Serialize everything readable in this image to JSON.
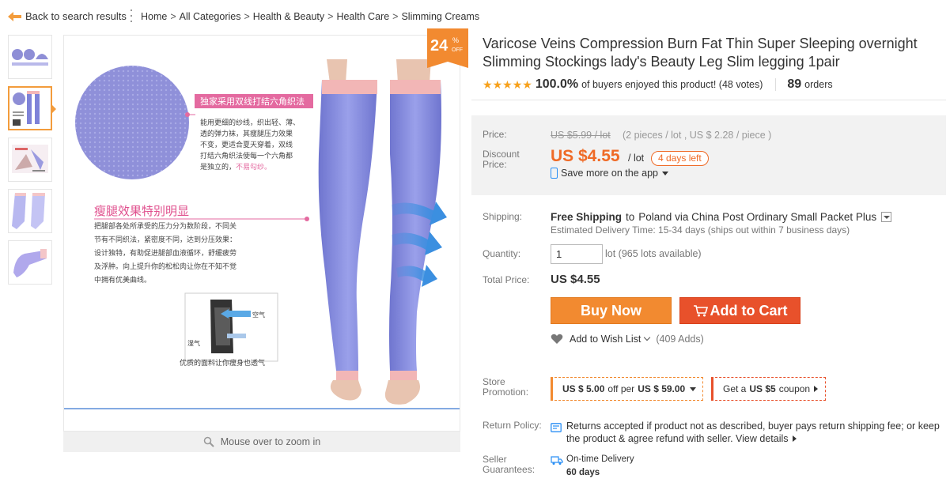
{
  "nav": {
    "back_label": "Back to search results",
    "breadcrumbs": [
      "Home",
      "All Categories",
      "Health & Beauty",
      "Health Care",
      "Slimming Creams"
    ],
    "crumb_sep": ">"
  },
  "gallery": {
    "thumbnail_count": 5,
    "active_index": 1,
    "zoom_hint": "Mouse over to zoom in",
    "main_image_text": {
      "callout_top": "独家采用双线打结六角织法",
      "callout_body": [
        "能用更细的纱线，织出轻、薄、",
        "透的弹力袜，其瘦腿压力效果",
        "不变，更适合夏天穿着，双线",
        "打结六角织法使每一个六角都",
        "是独立的，"
      ],
      "callout_pink": "不易勾纱。",
      "heading": "瘦腿效果特别明显",
      "body": [
        "把腿部各处所承受的压力分为数阶段，不同关",
        "节有不同织法，紧密度不同，达到分压效果：",
        "设计独特，有助促进腿部血液循环，舒缓疲劳",
        "及浮肿。向上提升你的松松肉让你在不知不觉",
        "中拥有优美曲线。"
      ],
      "air_label": "空气",
      "moist_label": "湿气",
      "fabric_caption": "优质的面料让你瘦身也透气"
    },
    "badge": {
      "percent": "24",
      "percent_sign": "%",
      "off": "OFF"
    }
  },
  "product": {
    "title": "Varicose Veins Compression Burn Fat Thin Super Sleeping overnight Slimming Stockings lady's Beauty Leg Slim legging 1pair",
    "rating_stars": 5,
    "rating_pct": "100.0%",
    "rating_text": "of buyers enjoyed this product! (48 votes)",
    "orders_count": "89",
    "orders_label": "orders"
  },
  "pricing": {
    "price_label": "Price:",
    "old_price": "US $5.99 / lot",
    "per_piece": "(2 pieces / lot , US $ 2.28 / piece )",
    "discount_label": "Discount Price:",
    "new_price": "US $4.55",
    "per_lot": "/ lot",
    "days_left": "4 days left",
    "app_text": "Save more on the app"
  },
  "shipping": {
    "label": "Shipping:",
    "free": "Free Shipping",
    "to": "to",
    "destination": "Poland via China Post Ordinary Small Packet Plus",
    "estimate": "Estimated Delivery Time: 15-34 days (ships out within 7 business days)"
  },
  "quantity": {
    "label": "Quantity:",
    "value": "1",
    "available": "lot (965 lots available)"
  },
  "total": {
    "label": "Total Price:",
    "value": "US $4.55"
  },
  "actions": {
    "buy_now": "Buy Now",
    "add_to_cart": "Add to Cart",
    "wish_list": "Add to Wish List",
    "wish_adds": "(409 Adds)"
  },
  "store_promotion": {
    "label": "Store Promotion:",
    "promo_a": {
      "amount": "US $ 5.00",
      "mid": "off per",
      "threshold": "US $ 59.00"
    },
    "promo_b": {
      "prefix": "Get a",
      "amount": "US $5",
      "suffix": "coupon"
    }
  },
  "return_policy": {
    "label": "Return Policy:",
    "text": "Returns accepted if product not as described, buyer pays return shipping fee; or keep the product & agree refund with seller.",
    "link": "View details"
  },
  "guarantees": {
    "label": "Seller Guarantees:",
    "ontime": "On-time Delivery",
    "days": "60 days"
  },
  "colors": {
    "accent_orange": "#f28a30",
    "cart_red": "#e8512b",
    "price_orange": "#ef6a26",
    "star_gold": "#f7a11b"
  }
}
